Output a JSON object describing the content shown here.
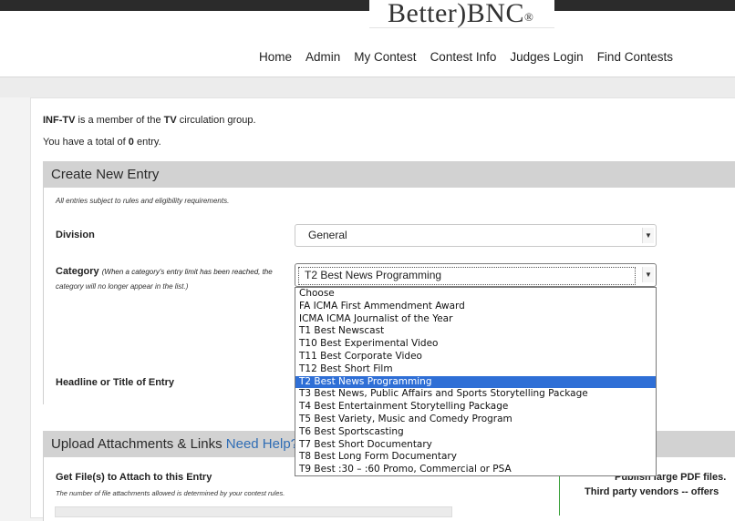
{
  "brand": {
    "logo_text": "Better)BNC",
    "logo_mark": "®"
  },
  "nav": [
    "Home",
    "Admin",
    "My Contest",
    "Contest Info",
    "Judges Login",
    "Find Contests"
  ],
  "membership": {
    "org": "INF-TV",
    "text1": " is a member of the ",
    "group": "TV",
    "text2": " circulation group."
  },
  "entries": {
    "prefix": "You have a total of ",
    "count": "0",
    "suffix": " entry."
  },
  "create_entry": {
    "title": "Create New Entry",
    "note": "All entries subject to rules and eligibility requirements.",
    "division_label": "Division",
    "division_value": "General",
    "category_label": "Category",
    "category_note_1": "(When a category's entry limit has been reached, the",
    "category_note_2": "category will no longer appear in the list.)",
    "category_value": "T2 Best News Programming",
    "headline_label": "Headline or Title of Entry",
    "category_options": [
      "Choose",
      "FA ICMA First Ammendment Award",
      "ICMA ICMA Journalist of the Year",
      "T1 Best Newscast",
      "T10 Best Experimental Video",
      "T11 Best Corporate Video",
      "T12 Best Short Film",
      "T2 Best News Programming",
      "T3 Best News, Public Affairs and Sports Storytelling Package",
      "T4 Best Entertainment Storytelling Package",
      "T5 Best Variety, Music and Comedy Program",
      "T6 Best Sportscasting",
      "T7 Best Short Documentary",
      "T8 Best Long Form Documentary",
      "T9 Best :30 – :60 Promo, Commercial or PSA"
    ],
    "selected_index": 7
  },
  "upload": {
    "title": "Upload Attachments & Links",
    "help": "Need Help?",
    "files_label": "Get File(s) to Attach to this Entry",
    "files_note": "The number of file attachments allowed is determined by your contest rules.",
    "right_text_1": "Publish large PDF files.",
    "right_text_2": "Third party vendors  --  offers"
  }
}
